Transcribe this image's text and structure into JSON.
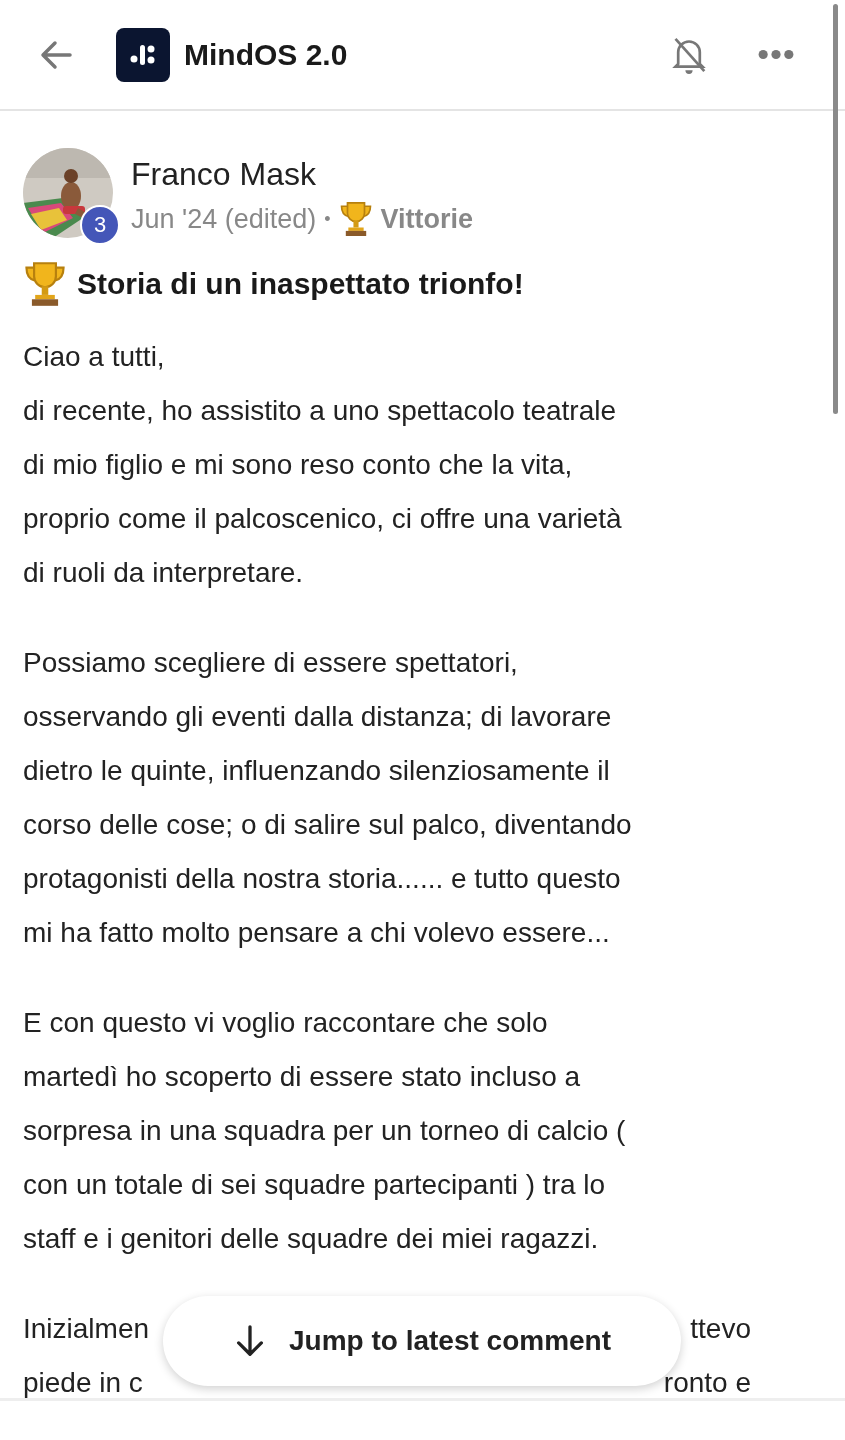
{
  "header": {
    "title": "MindOS 2.0"
  },
  "post": {
    "author": "Franco Mask",
    "badge": "3",
    "date": "Jun '24 (edited)",
    "separator": "•",
    "category": "Vittorie",
    "title": "Storia di un inaspettato trionfo!",
    "paragraphs": [
      {
        "lines": [
          "Ciao a tutti,",
          "di recente, ho assistito a uno spettacolo teatrale",
          "di mio figlio e mi sono reso conto che la vita,",
          "proprio come il palcoscenico, ci offre una varietà",
          "di ruoli da interpretare."
        ]
      },
      {
        "lines": [
          "Possiamo scegliere di essere spettatori,",
          "osservando gli eventi dalla distanza; di lavorare",
          "dietro le quinte, influenzando silenziosamente il",
          "corso delle cose; o di salire sul palco, diventando",
          "protagonisti della nostra storia...... e tutto questo",
          "mi ha fatto molto pensare a chi volevo essere..."
        ]
      },
      {
        "lines": [
          "E con questo vi voglio raccontare che solo",
          "martedì ho scoperto di essere stato incluso a",
          "sorpresa in una squadra per un torneo di calcio (",
          "con un totale di sei squadre partecipanti ) tra lo",
          "staff e i genitori delle squadre dei miei ragazzi."
        ]
      }
    ],
    "covered_lines": [
      {
        "start": "Inizialmen",
        "end": "ttevo"
      },
      {
        "start": "piede in c",
        "end": "ronto e"
      }
    ]
  },
  "jump_button": {
    "label": "Jump to latest comment"
  }
}
